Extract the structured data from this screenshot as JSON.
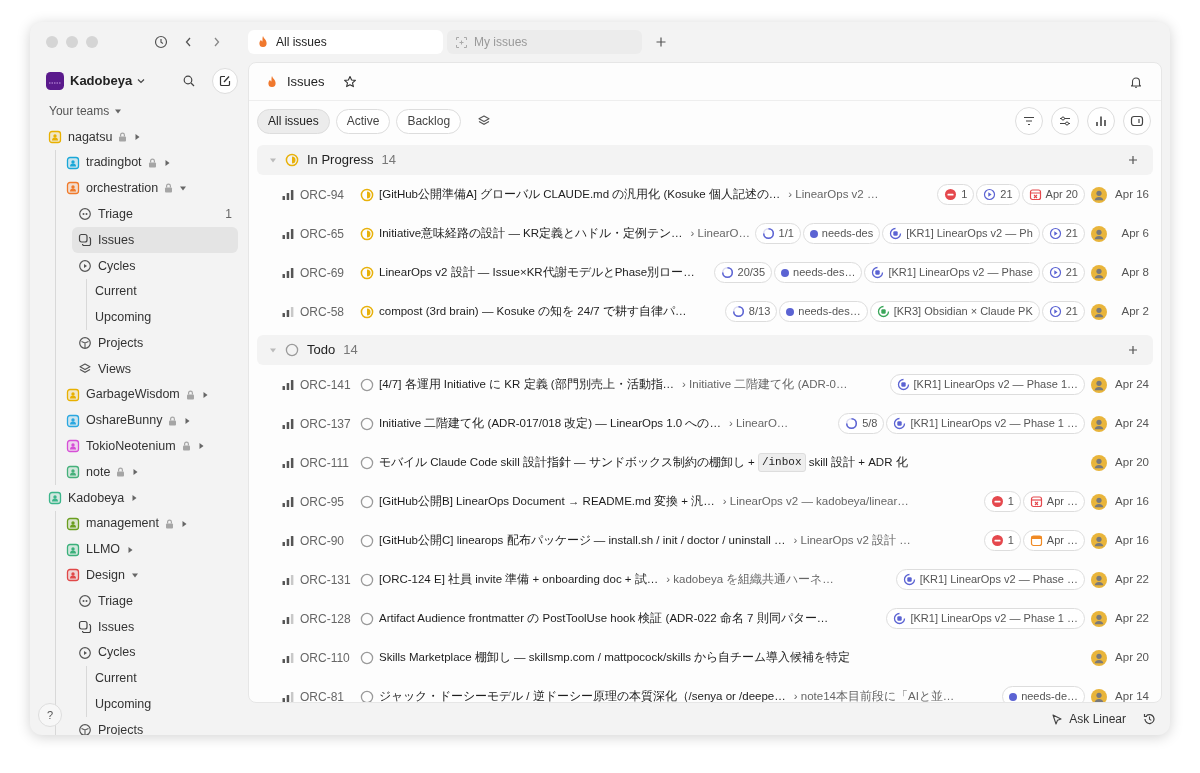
{
  "titlebar": {
    "tabs": [
      {
        "label": "All issues",
        "selected": true
      },
      {
        "label": "My issues",
        "selected": false
      }
    ]
  },
  "sidebar": {
    "workspace": "Kadobeya",
    "section_label": "Your teams",
    "help_label": "?",
    "items": [
      {
        "label": "nagatsu",
        "kind": "team",
        "color": "#e8b000",
        "locked": true,
        "expanded": false,
        "selected": false,
        "children": [
          {
            "label": "tradingbot",
            "kind": "team",
            "color": "#19a7d8",
            "locked": true,
            "expanded": false,
            "selected": false
          },
          {
            "label": "orchestration",
            "kind": "team",
            "color": "#f07a2a",
            "locked": true,
            "expanded": true,
            "selected": false,
            "children": [
              {
                "label": "Triage",
                "kind": "triage",
                "count": "1",
                "selected": false
              },
              {
                "label": "Issues",
                "kind": "issues",
                "selected": true
              },
              {
                "label": "Cycles",
                "kind": "cycles",
                "selected": false,
                "children": [
                  {
                    "label": "Current",
                    "selected": false
                  },
                  {
                    "label": "Upcoming",
                    "selected": false
                  }
                ]
              },
              {
                "label": "Projects",
                "kind": "projects",
                "selected": false
              },
              {
                "label": "Views",
                "kind": "views",
                "selected": false
              }
            ]
          },
          {
            "label": "GarbageWisdom",
            "kind": "team",
            "color": "#e8b000",
            "locked": true,
            "expanded": false,
            "selected": false
          },
          {
            "label": "OshareBunny",
            "kind": "team",
            "color": "#2aa7e0",
            "locked": true,
            "expanded": false,
            "selected": false
          },
          {
            "label": "TokioNeotenium",
            "kind": "team",
            "color": "#d64fd6",
            "locked": true,
            "expanded": false,
            "selected": false
          },
          {
            "label": "note",
            "kind": "team",
            "color": "#45b07a",
            "locked": true,
            "expanded": false,
            "selected": false
          }
        ]
      },
      {
        "label": "Kadobeya",
        "kind": "team",
        "color": "#3bb58a",
        "locked": false,
        "expanded": false,
        "selected": false,
        "children": [
          {
            "label": "management",
            "kind": "team",
            "color": "#6a9e1f",
            "locked": true,
            "expanded": false,
            "selected": false
          },
          {
            "label": "LLMO",
            "kind": "team",
            "color": "#3ab07a",
            "locked": false,
            "expanded": false,
            "selected": false
          },
          {
            "label": "Design",
            "kind": "team",
            "color": "#e04848",
            "locked": false,
            "expanded": true,
            "selected": false,
            "children": [
              {
                "label": "Triage",
                "kind": "triage",
                "selected": false
              },
              {
                "label": "Issues",
                "kind": "issues",
                "selected": false
              },
              {
                "label": "Cycles",
                "kind": "cycles",
                "selected": false,
                "children": [
                  {
                    "label": "Current",
                    "selected": false
                  },
                  {
                    "label": "Upcoming",
                    "selected": false
                  }
                ]
              },
              {
                "label": "Projects",
                "kind": "projects",
                "selected": false
              }
            ]
          }
        ]
      }
    ]
  },
  "main": {
    "title": "Issues",
    "filters": [
      {
        "label": "All issues",
        "selected": true
      },
      {
        "label": "Active",
        "selected": false
      },
      {
        "label": "Backlog",
        "selected": false
      }
    ],
    "groups": [
      {
        "label": "In Progress",
        "kind": "in_progress",
        "count": "14",
        "issues": [
          {
            "id": "ORC-94",
            "kind": "high",
            "title": "[GitHub公開準備A] グローバル CLAUDE.md の汎用化 (Kosuke 個人記述の…",
            "project": "› LinearOps v2 …",
            "chips": [
              {
                "kind": "blocked",
                "text": "1"
              },
              {
                "kind": "cycle",
                "text": "21"
              },
              {
                "kind": "due_overdue",
                "text": "Apr 20"
              }
            ],
            "date": "Apr 16"
          },
          {
            "id": "ORC-65",
            "kind": "high",
            "title": "Initiative意味経路の設計 — KR定義とハドル・定例テン…",
            "project": "› LinearO…",
            "chips": [
              {
                "kind": "progress",
                "text": "1/1"
              },
              {
                "kind": "label",
                "text": "needs-des",
                "color": "#5b63d3"
              },
              {
                "kind": "project",
                "text": "[KR1] LinearOps v2 — Ph",
                "color": "#5b63d3"
              },
              {
                "kind": "cycle",
                "text": "21"
              }
            ],
            "date": "Apr 6"
          },
          {
            "id": "ORC-69",
            "kind": "high",
            "title": "LinearOps v2 設計 — Issue×KR代謝モデルとPhase別ロー…",
            "chips": [
              {
                "kind": "progress",
                "text": "20/35"
              },
              {
                "kind": "label",
                "text": "needs-des…",
                "color": "#5b63d3"
              },
              {
                "kind": "project",
                "text": "[KR1] LinearOps v2 — Phase",
                "color": "#5b63d3"
              },
              {
                "kind": "cycle",
                "text": "21"
              }
            ],
            "date": "Apr 8"
          },
          {
            "id": "ORC-58",
            "kind": "medium",
            "title": "compost (3rd brain) — Kosuke の知を 24/7 で耕す自律パ…",
            "chips": [
              {
                "kind": "progress",
                "text": "8/13"
              },
              {
                "kind": "label",
                "text": "needs-des…",
                "color": "#5b63d3"
              },
              {
                "kind": "project",
                "text": "[KR3] Obsidian × Claude PK",
                "color": "#3aa65a"
              },
              {
                "kind": "cycle",
                "text": "21"
              }
            ],
            "date": "Apr 2"
          }
        ]
      },
      {
        "label": "Todo",
        "kind": "todo",
        "count": "14",
        "issues": [
          {
            "id": "ORC-141",
            "kind": "high",
            "title": "[4/7] 各運用 Initiative に KR 定義 (部門別売上・活動指…",
            "project": "› Initiative 二階建て化 (ADR-0…",
            "chips": [
              {
                "kind": "project",
                "text": "[KR1] LinearOps v2 — Phase 1…",
                "color": "#5b63d3"
              }
            ],
            "date": "Apr 24"
          },
          {
            "id": "ORC-137",
            "kind": "high",
            "title": "Initiative 二階建て化 (ADR-017/018 改定) — LinearOps 1.0 への…",
            "project": "› LinearO…",
            "chips": [
              {
                "kind": "progress",
                "text": "5/8"
              },
              {
                "kind": "project",
                "text": "[KR1] LinearOps v2 — Phase 1 …",
                "color": "#5b63d3"
              }
            ],
            "date": "Apr 24"
          },
          {
            "id": "ORC-111",
            "kind": "high",
            "title_parts": [
              {
                "text": "モバイル Claude Code skill 設計指針 — サンドボックス制約の棚卸し + "
              },
              {
                "text": "/inbox",
                "kind": "code"
              },
              {
                "text": " skill 設計 + ADR 化"
              }
            ],
            "date": "Apr 20"
          },
          {
            "id": "ORC-95",
            "kind": "high",
            "title": "[GitHub公開B] LinearOps Document → README.md 変換 + 汎…",
            "project": "› LinearOps v2 — kadobeya/linear…",
            "chips": [
              {
                "kind": "blocked",
                "text": "1"
              },
              {
                "kind": "due_overdue",
                "text": "Apr …"
              }
            ],
            "date": "Apr 16"
          },
          {
            "id": "ORC-90",
            "kind": "high",
            "title": "[GitHub公開C] linearops 配布パッケージ — install.sh / init / doctor / uninstall …",
            "project": "› LinearOps v2 設計 …",
            "chips": [
              {
                "kind": "blocked",
                "text": "1"
              },
              {
                "kind": "due",
                "text": "Apr …"
              }
            ],
            "date": "Apr 16"
          },
          {
            "id": "ORC-131",
            "kind": "medium",
            "title": "[ORC-124 E] 社員 invite 準備 + onboarding doc + 試…",
            "project": "› kadobeya を組織共通ハーネ…",
            "chips": [
              {
                "kind": "project",
                "text": "[KR1] LinearOps v2 — Phase …",
                "color": "#5b63d3"
              }
            ],
            "date": "Apr 22"
          },
          {
            "id": "ORC-128",
            "kind": "medium",
            "title": "Artifact Audience frontmatter の PostToolUse hook 検証 (ADR-022 命名 7 則同パター…",
            "chips": [
              {
                "kind": "project",
                "text": "[KR1] LinearOps v2 — Phase 1 …",
                "color": "#5b63d3"
              }
            ],
            "date": "Apr 22"
          },
          {
            "id": "ORC-110",
            "kind": "medium",
            "title": "Skills Marketplace 棚卸し — skillsmp.com / mattpocock/skills から自チーム導入候補を特定",
            "date": "Apr 20"
          },
          {
            "id": "ORC-81",
            "kind": "medium",
            "title": "ジャック・ドーシーモデル / 逆ドーシー原理の本質深化（/senya or /deepe…",
            "project": "› note14本目前段に「AIと並…",
            "chips": [
              {
                "kind": "label",
                "text": "needs-de…",
                "color": "#5b63d3"
              }
            ],
            "date": "Apr 14"
          }
        ]
      }
    ]
  },
  "footer": {
    "ask_label": "Ask Linear"
  }
}
